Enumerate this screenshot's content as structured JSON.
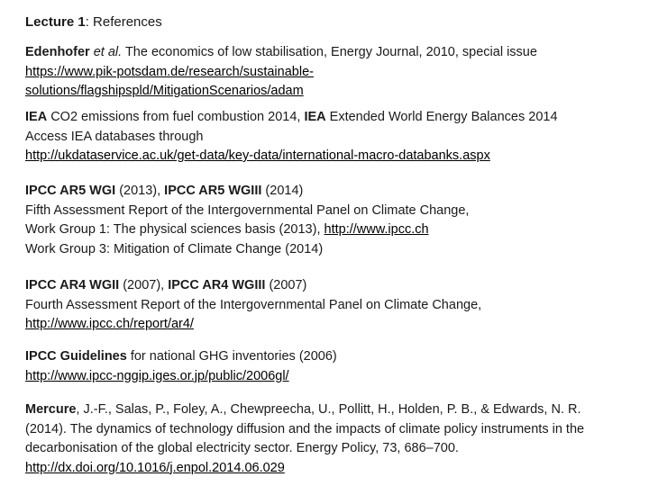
{
  "title": {
    "bold": "Lecture 1",
    "rest": ": References"
  },
  "refs": {
    "edenhofer": {
      "author": "Edenhofer",
      "etal": "et al.",
      "text": " The economics of low stabilisation, Energy Journal, 2010, special issue",
      "url_line1": "https://www.pik-potsdam.de/research/sustainable-",
      "url_line2": "solutions/flagshipspld/MitigationScenarios/adam"
    },
    "iea": {
      "org1": "IEA",
      "text1": " CO2 emissions from fuel combustion 2014, ",
      "org2": "IEA",
      "text2": " Extended World Energy Balances 2014",
      "line2": "Access IEA databases through",
      "url": "http://ukdataservice.ac.uk/get-data/key-data/international-macro-databanks.aspx"
    },
    "ar5": {
      "b1": "IPCC AR5 WGI",
      "t1": " (2013), ",
      "b2": "IPCC AR5 WGIII",
      "t2": " (2014)",
      "line2": "Fifth Assessment Report of the Intergovernmental Panel on Climate Change,",
      "line3_text": "Work Group 1: The physical sciences basis (2013), ",
      "line3_url": "http://www.ipcc.ch",
      "line4": "Work Group 3: Mitigation of Climate Change (2014)"
    },
    "ar4": {
      "b1": "IPCC AR4 WGII",
      "t1": " (2007), ",
      "b2": "IPCC AR4 WGIII",
      "t2": " (2007)",
      "line2": "Fourth Assessment Report of the Intergovernmental Panel on Climate Change,",
      "url": "http://www.ipcc.ch/report/ar4/"
    },
    "guidelines": {
      "b1": "IPCC Guidelines",
      "t1": " for national GHG inventories (2006)",
      "url": "http://www.ipcc-nggip.iges.or.jp/public/2006gl/"
    },
    "mercure": {
      "author": "Mercure",
      "line1_rest": ", J.-F., Salas, P., Foley, A., Chewpreecha, U., Pollitt, H., Holden, P. B., & Edwards, N. R.",
      "line2": "(2014). The dynamics of technology diffusion and the impacts of climate policy instruments in the",
      "line3": "decarbonisation of the global electricity sector. Energy Policy, 73, 686–700.",
      "url": "http://dx.doi.org/10.1016/j.enpol.2014.06.029"
    }
  }
}
